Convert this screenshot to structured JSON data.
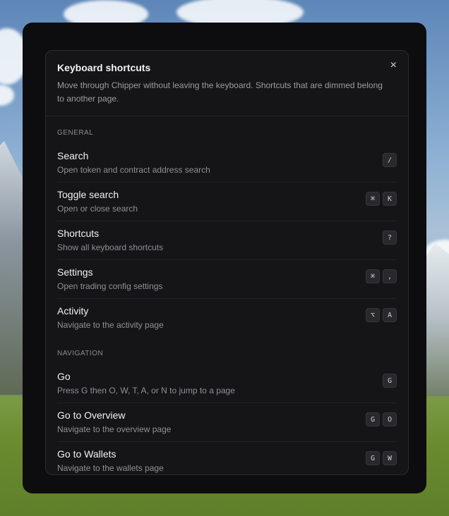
{
  "modal": {
    "title": "Keyboard shortcuts",
    "description": "Move through Chipper without leaving the keyboard. Shortcuts that are dimmed belong to another page.",
    "close_icon": "×"
  },
  "sections": [
    {
      "label": "GENERAL",
      "items": [
        {
          "title": "Search",
          "desc": "Open token and contract address search",
          "keys": [
            "/"
          ]
        },
        {
          "title": "Toggle search",
          "desc": "Open or close search",
          "keys": [
            "⌘",
            "K"
          ]
        },
        {
          "title": "Shortcuts",
          "desc": "Show all keyboard shortcuts",
          "keys": [
            "?"
          ]
        },
        {
          "title": "Settings",
          "desc": "Open trading config settings",
          "keys": [
            "⌘",
            ","
          ]
        },
        {
          "title": "Activity",
          "desc": "Navigate to the activity page",
          "keys": [
            "⌥",
            "A"
          ]
        }
      ]
    },
    {
      "label": "NAVIGATION",
      "items": [
        {
          "title": "Go",
          "desc": "Press G then O, W, T, A, or N to jump to a page",
          "keys": [
            "G"
          ]
        },
        {
          "title": "Go to Overview",
          "desc": "Navigate to the overview page",
          "keys": [
            "G",
            "O"
          ]
        },
        {
          "title": "Go to Wallets",
          "desc": "Navigate to the wallets page",
          "keys": [
            "G",
            "W"
          ]
        }
      ]
    }
  ]
}
